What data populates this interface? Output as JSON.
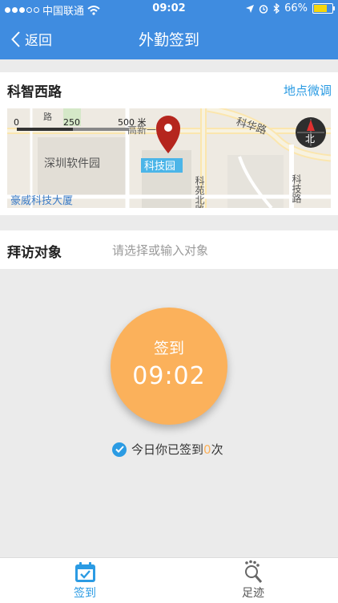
{
  "status_bar": {
    "carrier": "中国联通",
    "time": "09:02",
    "battery": "66%"
  },
  "nav": {
    "back_label": "返回",
    "title": "外勤签到"
  },
  "location": {
    "name": "科智西路",
    "adjust_label": "地点微调"
  },
  "map": {
    "scale_0": "0",
    "scale_250": "250",
    "scale_500": "500 米",
    "road_kehua": "科华路",
    "road_gaoxin": "高新一道",
    "area_software_park": "深圳软件园",
    "pin_label": "科技园",
    "road_keyuan_north": "科苑北路",
    "road_keji": "科技路",
    "poi_building": "豪威科技大厦",
    "compass_label": "北",
    "road_lu": "路"
  },
  "visit": {
    "label": "拜访对象",
    "placeholder": "请选择或输入对象"
  },
  "checkin": {
    "label": "签到",
    "time": "09:02"
  },
  "count": {
    "prefix": "今日你已签到",
    "number": "0",
    "suffix": "次"
  },
  "tabs": [
    {
      "label": "签到",
      "icon": "calendar-check-icon"
    },
    {
      "label": "足迹",
      "icon": "footprint-search-icon"
    }
  ],
  "colors": {
    "primary": "#3f8ce0",
    "accent": "#2b9be3",
    "checkin": "#fbb15b"
  }
}
